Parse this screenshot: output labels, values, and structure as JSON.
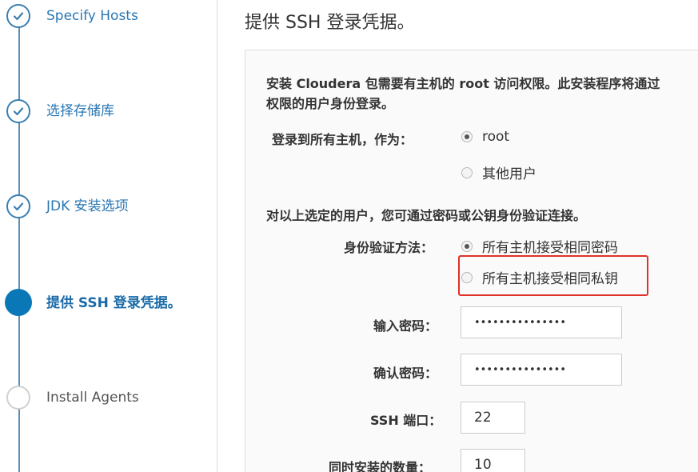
{
  "wizard": {
    "steps": [
      {
        "label": "Specify Hosts",
        "state": "done"
      },
      {
        "label": "选择存储库",
        "state": "done"
      },
      {
        "label": "JDK 安装选项",
        "state": "done"
      },
      {
        "label": "提供 SSH 登录凭据。",
        "state": "active"
      },
      {
        "label": "Install Agents",
        "state": "pending"
      }
    ]
  },
  "main": {
    "title": "提供 SSH 登录凭据。",
    "intro_line1": "安装 Cloudera 包需要有主机的 root 访问权限。此安装程序将通过",
    "intro_line2": "权限的用户身份登录。",
    "login_as": {
      "label": "登录到所有主机，作为：",
      "options": [
        {
          "label": "root",
          "checked": true
        },
        {
          "label": "其他用户",
          "checked": false
        }
      ]
    },
    "auth_note": "对以上选定的用户，您可通过密码或公钥身份验证连接。",
    "auth_method": {
      "label": "身份验证方法：",
      "options": [
        {
          "label": "所有主机接受相同密码",
          "checked": true
        },
        {
          "label": "所有主机接受相同私钥",
          "checked": false
        }
      ]
    },
    "password": {
      "label": "输入密码：",
      "value": "•••••••••••••••"
    },
    "confirm_password": {
      "label": "确认密码：",
      "value": "•••••••••••••••"
    },
    "ssh_port": {
      "label": "SSH 端口：",
      "value": "22"
    },
    "simultaneous": {
      "label": "同时安装的数量：",
      "value": "10"
    }
  },
  "colors": {
    "accent": "#0a78b6",
    "step_done": "#3a7fb0",
    "highlight": "#e0312a"
  },
  "icons": {
    "done": "check-circle-icon",
    "active": "filled-circle-icon",
    "pending": "empty-circle-icon"
  }
}
